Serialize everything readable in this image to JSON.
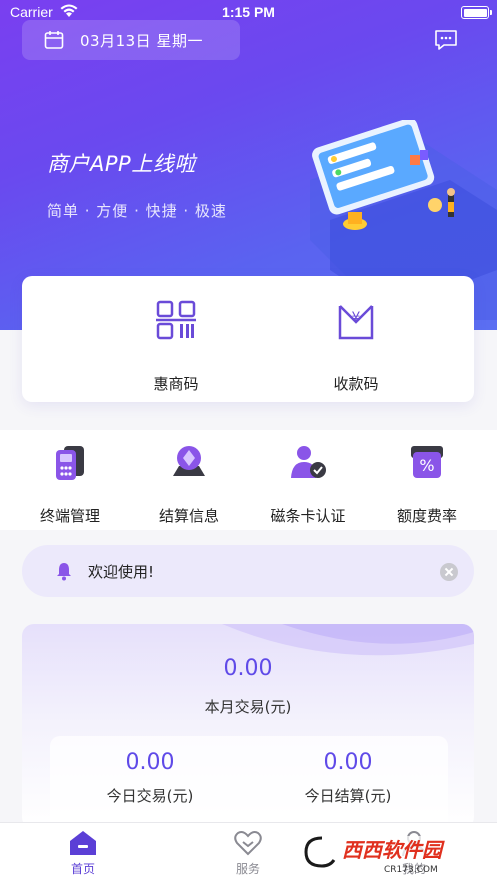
{
  "status_bar": {
    "carrier": "Carrier",
    "time": "1:15 PM"
  },
  "header": {
    "date": "03月13日 星期一"
  },
  "banner": {
    "title": "商户APP上线啦",
    "subtitle": "简单 · 方便 · 快捷 · 极速"
  },
  "main_actions": [
    {
      "label": "惠商码",
      "icon": "qr-code-icon"
    },
    {
      "label": "收款码",
      "icon": "yuan-receipt-icon"
    }
  ],
  "quick_actions": [
    {
      "label": "终端管理",
      "icon": "pos-terminal-icon"
    },
    {
      "label": "结算信息",
      "icon": "settlement-icon"
    },
    {
      "label": "磁条卡认证",
      "icon": "card-auth-icon"
    },
    {
      "label": "额度费率",
      "icon": "rate-icon"
    }
  ],
  "notice": {
    "text": "欢迎使用!"
  },
  "stats": {
    "month_value": "0.00",
    "month_label": "本月交易(元)",
    "today_trade_value": "0.00",
    "today_trade_label": "今日交易(元)",
    "today_settle_value": "0.00",
    "today_settle_label": "今日结算(元)"
  },
  "tabs": [
    {
      "label": "首页",
      "icon": "home-icon",
      "active": true
    },
    {
      "label": "服务",
      "icon": "heart-icon",
      "active": false
    },
    {
      "label": "我的",
      "icon": "user-icon",
      "active": false
    }
  ],
  "watermark": {
    "text": "西西软件园",
    "url_text": "CR173.COM"
  },
  "colors": {
    "primary": "#6a49ef",
    "accent_text": "#5f4ae8",
    "active_tab": "#5b3fd6",
    "inactive_tab": "#8a8a92"
  }
}
